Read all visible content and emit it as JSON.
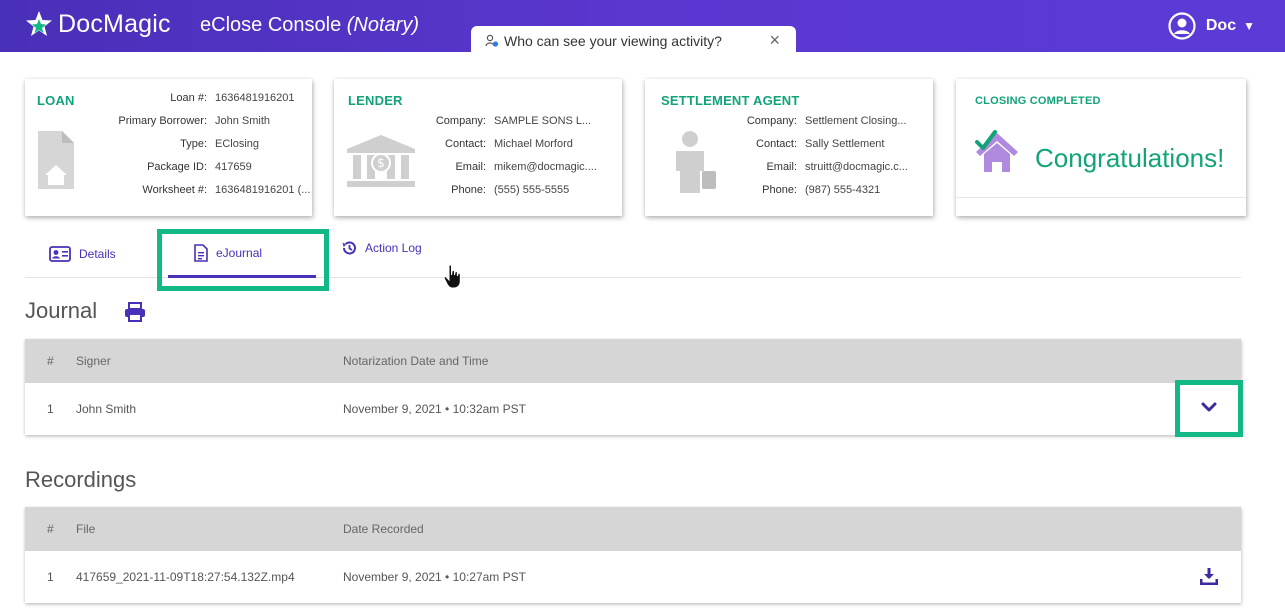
{
  "app": {
    "brand": "DocMagic",
    "console_title": "eClose Console",
    "console_role": "(Notary)",
    "brand_color": "#5a37cf",
    "accent_color": "#12a37a"
  },
  "privacy_popover": {
    "text": "Who can see your viewing activity?",
    "close_label": "×"
  },
  "user": {
    "name": "Doc"
  },
  "cards": {
    "loan": {
      "title": "LOAN",
      "fields": [
        {
          "label": "Loan #:",
          "value": "1636481916201"
        },
        {
          "label": "Primary Borrower:",
          "value": "John Smith"
        },
        {
          "label": "Type:",
          "value": "EClosing"
        },
        {
          "label": "Package ID:",
          "value": "417659"
        },
        {
          "label": "Worksheet #:",
          "value": "1636481916201 (..."
        }
      ]
    },
    "lender": {
      "title": "LENDER",
      "fields": [
        {
          "label": "Company:",
          "value": "SAMPLE SONS L..."
        },
        {
          "label": "Contact:",
          "value": "Michael Morford"
        },
        {
          "label": "Email:",
          "value": "mikem@docmagic...."
        },
        {
          "label": "Phone:",
          "value": "(555) 555-5555"
        }
      ]
    },
    "settlement_agent": {
      "title": "SETTLEMENT AGENT",
      "fields": [
        {
          "label": "Company:",
          "value": "Settlement Closing..."
        },
        {
          "label": "Contact:",
          "value": "Sally Settlement"
        },
        {
          "label": "Email:",
          "value": "struitt@docmagic.c..."
        },
        {
          "label": "Phone:",
          "value": "(987) 555-4321"
        }
      ]
    },
    "closing": {
      "title": "CLOSING COMPLETED",
      "message": "Congratulations!"
    }
  },
  "tabs": [
    {
      "label": "Details",
      "icon": "id-card-icon"
    },
    {
      "label": "eJournal",
      "icon": "document-icon",
      "active": true
    },
    {
      "label": "Action Log",
      "icon": "history-icon"
    }
  ],
  "journal": {
    "title": "Journal",
    "columns": [
      "#",
      "Signer",
      "Notarization Date and Time"
    ],
    "rows": [
      {
        "num": "1",
        "signer": "John Smith",
        "datetime": "November 9, 2021 • 10:32am PST"
      }
    ]
  },
  "recordings": {
    "title": "Recordings",
    "columns": [
      "#",
      "File",
      "Date Recorded"
    ],
    "rows": [
      {
        "num": "1",
        "file": "417659_2021-11-09T18:27:54.132Z.mp4",
        "date": "November 9, 2021 • 10:27am PST"
      }
    ]
  }
}
